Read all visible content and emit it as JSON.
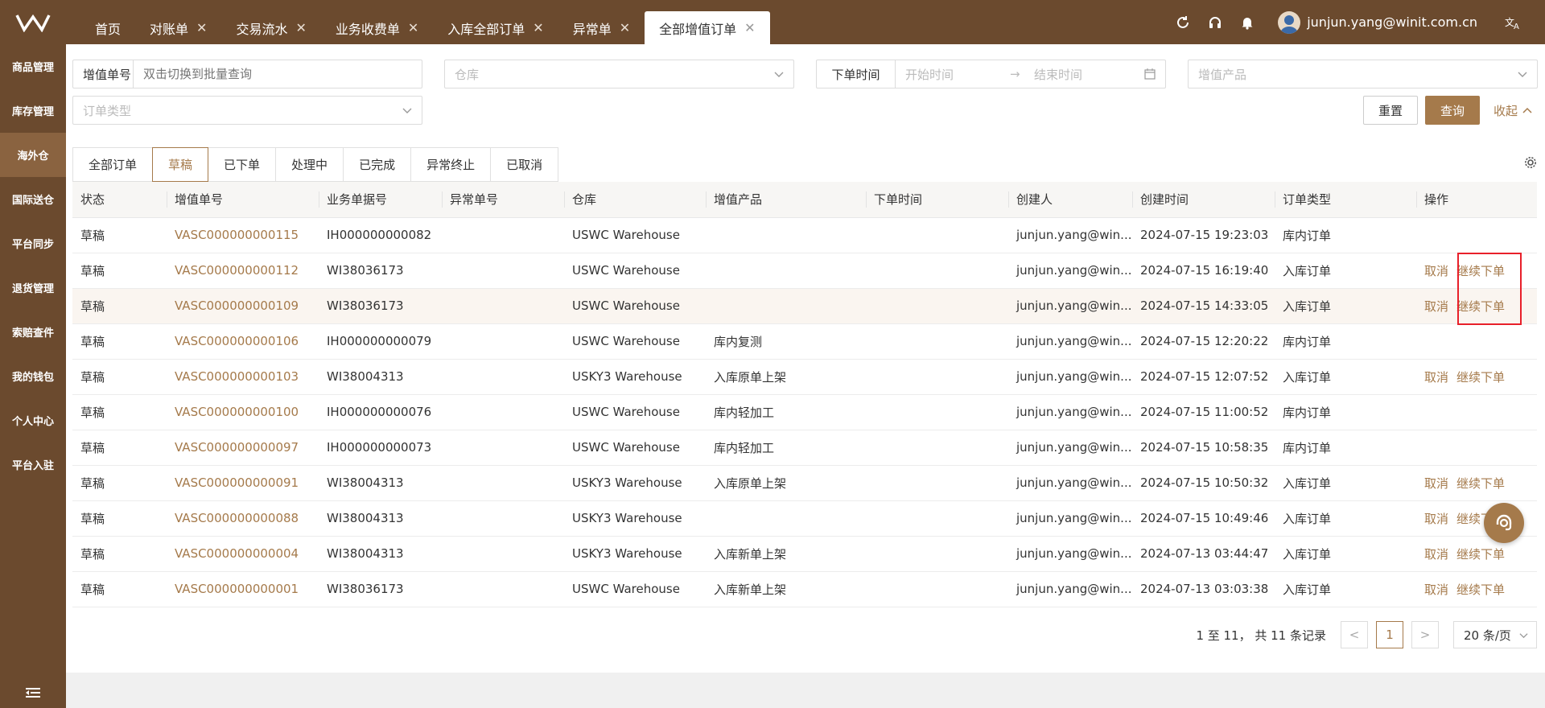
{
  "header": {
    "tabs": [
      {
        "label": "首页",
        "closable": false,
        "active": false
      },
      {
        "label": "对账单",
        "closable": true,
        "active": false
      },
      {
        "label": "交易流水",
        "closable": true,
        "active": false
      },
      {
        "label": "业务收费单",
        "closable": true,
        "active": false
      },
      {
        "label": "入库全部订单",
        "closable": true,
        "active": false
      },
      {
        "label": "异常单",
        "closable": true,
        "active": false
      },
      {
        "label": "全部增值订单",
        "closable": true,
        "active": true
      }
    ],
    "close_glyph": "✕",
    "user_email": "junjun.yang@winit.com.cn",
    "icons": [
      "refresh-icon",
      "headset-icon",
      "bell-icon",
      "translate-icon"
    ]
  },
  "sidebar": {
    "items": [
      {
        "label": "商品管理",
        "active": false
      },
      {
        "label": "库存管理",
        "active": false
      },
      {
        "label": "海外仓",
        "active": true
      },
      {
        "label": "国际送仓",
        "active": false
      },
      {
        "label": "平台同步",
        "active": false
      },
      {
        "label": "退货管理",
        "active": false
      },
      {
        "label": "索赔查件",
        "active": false
      },
      {
        "label": "我的钱包",
        "active": false
      },
      {
        "label": "个人中心",
        "active": false
      },
      {
        "label": "平台入驻",
        "active": false
      }
    ]
  },
  "filters": {
    "search_type": "增值单号",
    "search_placeholder": "双击切换到批量查询",
    "warehouse_placeholder": "仓库",
    "order_time_label": "下单时间",
    "start_placeholder": "开始时间",
    "end_placeholder": "结束时间",
    "range_arrow": "→",
    "product_placeholder": "增值产品",
    "order_type_placeholder": "订单类型",
    "reset_label": "重置",
    "query_label": "查询",
    "collapse_label": "收起"
  },
  "status_tabs": [
    {
      "label": "全部订单",
      "active": false
    },
    {
      "label": "草稿",
      "active": true
    },
    {
      "label": "已下单",
      "active": false
    },
    {
      "label": "处理中",
      "active": false
    },
    {
      "label": "已完成",
      "active": false
    },
    {
      "label": "异常终止",
      "active": false
    },
    {
      "label": "已取消",
      "active": false
    }
  ],
  "table": {
    "columns": [
      "状态",
      "增值单号",
      "业务单据号",
      "异常单号",
      "仓库",
      "增值产品",
      "下单时间",
      "创建人",
      "创建时间",
      "订单类型",
      "操作"
    ],
    "cancel_label": "取消",
    "continue_label": "继续下单",
    "rows": [
      {
        "status": "草稿",
        "vas_no": "VASC000000000115",
        "biz_no": "IH000000000082",
        "exc_no": "",
        "warehouse": "USWC Warehouse",
        "product": "",
        "order_time": "",
        "creator": "junjun.yang@win...",
        "created": "2024-07-15 19:23:03",
        "order_type": "库内订单",
        "actions": false,
        "highlight": false
      },
      {
        "status": "草稿",
        "vas_no": "VASC000000000112",
        "biz_no": "WI38036173",
        "exc_no": "",
        "warehouse": "USWC Warehouse",
        "product": "",
        "order_time": "",
        "creator": "junjun.yang@win...",
        "created": "2024-07-15 16:19:40",
        "order_type": "入库订单",
        "actions": true,
        "highlight": false
      },
      {
        "status": "草稿",
        "vas_no": "VASC000000000109",
        "biz_no": "WI38036173",
        "exc_no": "",
        "warehouse": "USWC Warehouse",
        "product": "",
        "order_time": "",
        "creator": "junjun.yang@win...",
        "created": "2024-07-15 14:33:05",
        "order_type": "入库订单",
        "actions": true,
        "highlight": true
      },
      {
        "status": "草稿",
        "vas_no": "VASC000000000106",
        "biz_no": "IH000000000079",
        "exc_no": "",
        "warehouse": "USWC Warehouse",
        "product": "库内复测",
        "order_time": "",
        "creator": "junjun.yang@win...",
        "created": "2024-07-15 12:20:22",
        "order_type": "库内订单",
        "actions": false,
        "highlight": false
      },
      {
        "status": "草稿",
        "vas_no": "VASC000000000103",
        "biz_no": "WI38004313",
        "exc_no": "",
        "warehouse": "USKY3 Warehouse",
        "product": "入库原单上架",
        "order_time": "",
        "creator": "junjun.yang@win...",
        "created": "2024-07-15 12:07:52",
        "order_type": "入库订单",
        "actions": true,
        "highlight": false
      },
      {
        "status": "草稿",
        "vas_no": "VASC000000000100",
        "biz_no": "IH000000000076",
        "exc_no": "",
        "warehouse": "USWC Warehouse",
        "product": "库内轻加工",
        "order_time": "",
        "creator": "junjun.yang@win...",
        "created": "2024-07-15 11:00:52",
        "order_type": "库内订单",
        "actions": false,
        "highlight": false
      },
      {
        "status": "草稿",
        "vas_no": "VASC000000000097",
        "biz_no": "IH000000000073",
        "exc_no": "",
        "warehouse": "USWC Warehouse",
        "product": "库内轻加工",
        "order_time": "",
        "creator": "junjun.yang@win...",
        "created": "2024-07-15 10:58:35",
        "order_type": "库内订单",
        "actions": false,
        "highlight": false
      },
      {
        "status": "草稿",
        "vas_no": "VASC000000000091",
        "biz_no": "WI38004313",
        "exc_no": "",
        "warehouse": "USKY3 Warehouse",
        "product": "入库原单上架",
        "order_time": "",
        "creator": "junjun.yang@win...",
        "created": "2024-07-15 10:50:32",
        "order_type": "入库订单",
        "actions": true,
        "highlight": false
      },
      {
        "status": "草稿",
        "vas_no": "VASC000000000088",
        "biz_no": "WI38004313",
        "exc_no": "",
        "warehouse": "USKY3 Warehouse",
        "product": "",
        "order_time": "",
        "creator": "junjun.yang@win...",
        "created": "2024-07-15 10:49:46",
        "order_type": "入库订单",
        "actions": true,
        "highlight": false
      },
      {
        "status": "草稿",
        "vas_no": "VASC000000000004",
        "biz_no": "WI38004313",
        "exc_no": "",
        "warehouse": "USKY3 Warehouse",
        "product": "入库新单上架",
        "order_time": "",
        "creator": "junjun.yang@win...",
        "created": "2024-07-13 03:44:47",
        "order_type": "入库订单",
        "actions": true,
        "highlight": false
      },
      {
        "status": "草稿",
        "vas_no": "VASC000000000001",
        "biz_no": "WI38036173",
        "exc_no": "",
        "warehouse": "USWC Warehouse",
        "product": "入库新单上架",
        "order_time": "",
        "creator": "junjun.yang@win...",
        "created": "2024-07-13 03:03:38",
        "order_type": "入库订单",
        "actions": true,
        "highlight": false
      }
    ]
  },
  "pagination": {
    "summary": "1 至 11， 共 11 条记录",
    "prev": "<",
    "current_page": "1",
    "next": ">",
    "page_size": "20 条/页"
  },
  "colors": {
    "brand": "#6b4a2e",
    "accent": "#a57a4b",
    "highlight_box": "#e8202a"
  }
}
